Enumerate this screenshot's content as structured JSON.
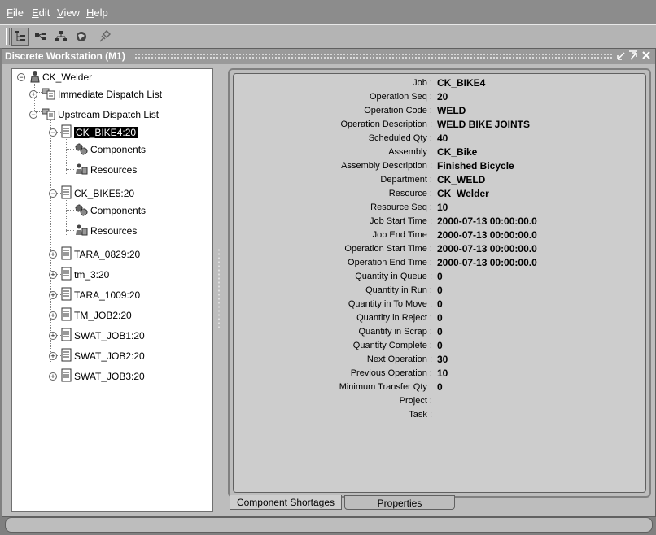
{
  "menu": {
    "file": "File",
    "edit": "Edit",
    "view": "View",
    "help": "Help"
  },
  "toolbar_icons": [
    "tree-view-icon",
    "dispatch-list-icon",
    "hierarchy-icon",
    "globe-icon",
    "pin-icon"
  ],
  "window": {
    "title": "Discrete Workstation (M1)"
  },
  "tree": {
    "root": "CK_Welder",
    "immediate": "Immediate Dispatch List",
    "upstream": "Upstream Dispatch List",
    "jobs": [
      {
        "label": "CK_BIKE4:20",
        "selected": true,
        "expanded": true,
        "children": [
          "Components",
          "Resources"
        ]
      },
      {
        "label": "CK_BIKE5:20",
        "selected": false,
        "expanded": true,
        "children": [
          "Components",
          "Resources"
        ]
      },
      {
        "label": "TARA_0829:20",
        "selected": false,
        "expanded": false
      },
      {
        "label": "tm_3:20",
        "selected": false,
        "expanded": false
      },
      {
        "label": "TARA_1009:20",
        "selected": false,
        "expanded": false
      },
      {
        "label": "TM_JOB2:20",
        "selected": false,
        "expanded": false
      },
      {
        "label": "SWAT_JOB1:20",
        "selected": false,
        "expanded": false
      },
      {
        "label": "SWAT_JOB2:20",
        "selected": false,
        "expanded": false
      },
      {
        "label": "SWAT_JOB3:20",
        "selected": false,
        "expanded": false
      }
    ]
  },
  "properties": [
    {
      "label": "Job :",
      "value": "CK_BIKE4"
    },
    {
      "label": "Operation Seq :",
      "value": "20"
    },
    {
      "label": "Operation Code :",
      "value": "WELD"
    },
    {
      "label": "Operation Description :",
      "value": "WELD BIKE JOINTS"
    },
    {
      "label": "Scheduled Qty :",
      "value": "40"
    },
    {
      "label": "Assembly :",
      "value": "CK_Bike"
    },
    {
      "label": "Assembly Description :",
      "value": "Finished Bicycle"
    },
    {
      "label": "Department :",
      "value": "CK_WELD"
    },
    {
      "label": "Resource :",
      "value": "CK_Welder"
    },
    {
      "label": "Resource Seq :",
      "value": "10"
    },
    {
      "label": "Job Start Time :",
      "value": "2000-07-13 00:00:00.0"
    },
    {
      "label": "Job End Time :",
      "value": "2000-07-13 00:00:00.0"
    },
    {
      "label": "Operation Start Time :",
      "value": "2000-07-13 00:00:00.0"
    },
    {
      "label": "Operation End Time :",
      "value": "2000-07-13 00:00:00.0"
    },
    {
      "label": "Quantity in Queue :",
      "value": "0"
    },
    {
      "label": "Quantity in Run :",
      "value": "0"
    },
    {
      "label": "Quantity in To Move :",
      "value": "0"
    },
    {
      "label": "Quantity in Reject :",
      "value": "0"
    },
    {
      "label": "Quantity in Scrap :",
      "value": "0"
    },
    {
      "label": "Quantity Complete :",
      "value": "0"
    },
    {
      "label": "Next Operation :",
      "value": "30"
    },
    {
      "label": "Previous Operation :",
      "value": "10"
    },
    {
      "label": "Minimum Transfer Qty :",
      "value": "0"
    },
    {
      "label": "Project :",
      "value": ""
    },
    {
      "label": "Task :",
      "value": ""
    }
  ],
  "tabs": {
    "component_shortages": "Component Shortages",
    "properties": "Properties"
  }
}
